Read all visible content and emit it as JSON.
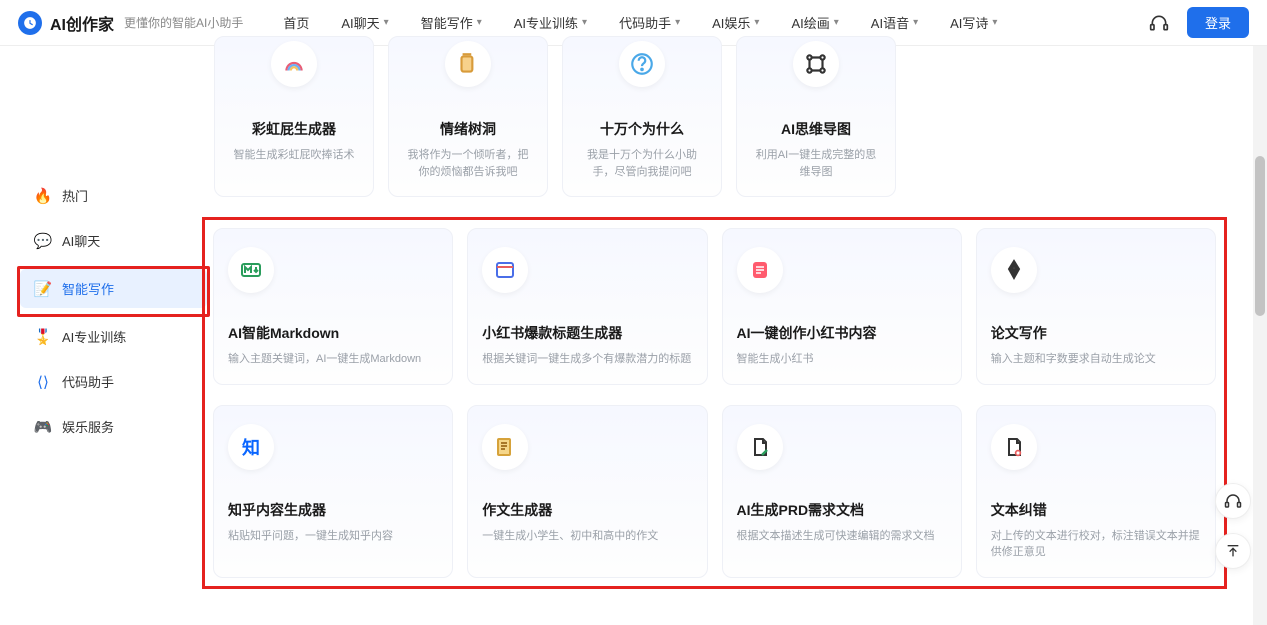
{
  "header": {
    "app_name": "AI创作家",
    "slogan": "更懂你的智能AI小助手",
    "nav": [
      "首页",
      "AI聊天",
      "智能写作",
      "AI专业训练",
      "代码助手",
      "AI娱乐",
      "AI绘画",
      "AI语音",
      "AI写诗"
    ],
    "nav_has_dropdown": [
      false,
      true,
      true,
      true,
      true,
      true,
      true,
      true,
      true
    ],
    "login": "登录"
  },
  "sidebar": {
    "items": [
      {
        "icon": "fire",
        "label": "热门",
        "color": "#FF8A3D"
      },
      {
        "icon": "chat",
        "label": "AI聊天",
        "color": "#3D8BFF"
      },
      {
        "icon": "doc",
        "label": "智能写作",
        "color": "#1F6FEB"
      },
      {
        "icon": "badge",
        "label": "AI专业训练",
        "color": "#7B8794"
      },
      {
        "icon": "code",
        "label": "代码助手",
        "color": "#1F6FEB"
      },
      {
        "icon": "game",
        "label": "娱乐服务",
        "color": "#1F6FEB"
      }
    ],
    "active_index": 2
  },
  "top_row": [
    {
      "title": "彩虹屁生成器",
      "desc": "智能生成彩虹屁吹捧话术"
    },
    {
      "title": "情绪树洞",
      "desc": "我将作为一个倾听者，把你的烦恼都告诉我吧"
    },
    {
      "title": "十万个为什么",
      "desc": "我是十万个为什么小助手，尽管向我提问吧"
    },
    {
      "title": "AI思维导图",
      "desc": "利用AI一键生成完整的思维导图"
    }
  ],
  "grid": [
    [
      {
        "title": "AI智能Markdown",
        "desc": "输入主题关键词，AI一键生成Markdown"
      },
      {
        "title": "小红书爆款标题生成器",
        "desc": "根据关键词一键生成多个有爆款潜力的标题"
      },
      {
        "title": "AI一键创作小红书内容",
        "desc": "智能生成小红书"
      },
      {
        "title": "论文写作",
        "desc": "输入主题和字数要求自动生成论文"
      }
    ],
    [
      {
        "title": "知乎内容生成器",
        "desc": "粘贴知乎问题，一键生成知乎内容"
      },
      {
        "title": "作文生成器",
        "desc": "一键生成小学生、初中和高中的作文"
      },
      {
        "title": "AI生成PRD需求文档",
        "desc": "根据文本描述生成可快速编辑的需求文档"
      },
      {
        "title": "文本纠错",
        "desc": "对上传的文本进行校对，标注错误文本并提供修正意见"
      }
    ]
  ],
  "colors": {
    "accent": "#1F6FEB",
    "highlight": "#e5221f"
  }
}
